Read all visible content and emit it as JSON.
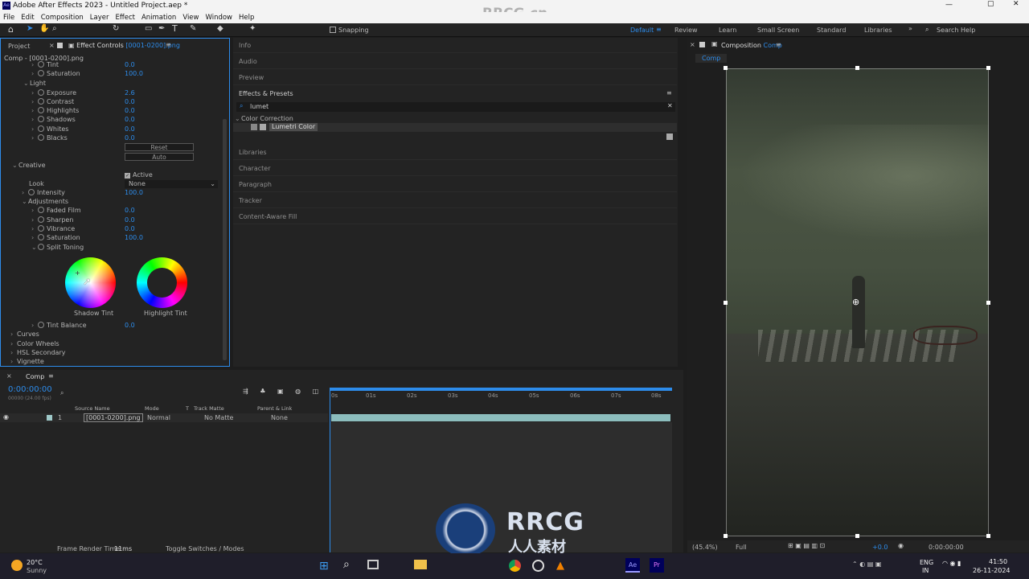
{
  "app": {
    "title": "Adobe After Effects 2023 - Untitled Project.aep *",
    "menu": [
      "File",
      "Edit",
      "Composition",
      "Layer",
      "Effect",
      "Animation",
      "View",
      "Window",
      "Help"
    ]
  },
  "watermark": "RRCG.cn",
  "toolbar": {
    "snapping": "Snapping",
    "workspaces": [
      "Default",
      "Review",
      "Learn",
      "Small Screen",
      "Standard",
      "Libraries"
    ],
    "search_placeholder": "Search Help"
  },
  "left_panel": {
    "tab_project": "Project",
    "tab_effect": "Effect Controls",
    "tab_effect_layer": "[0001-0200].png",
    "breadcrumb": "Comp - [0001-0200].png",
    "rows": [
      {
        "label": "Tint",
        "value": "0.0"
      },
      {
        "label": "Saturation",
        "value": "100.0"
      },
      {
        "label": "Light",
        "value": ""
      },
      {
        "label": "Exposure",
        "value": "2.6"
      },
      {
        "label": "Contrast",
        "value": "0.0"
      },
      {
        "label": "Highlights",
        "value": "0.0"
      },
      {
        "label": "Shadows",
        "value": "0.0"
      },
      {
        "label": "Whites",
        "value": "0.0"
      },
      {
        "label": "Blacks",
        "value": "0.0"
      }
    ],
    "reset": "Reset",
    "auto": "Auto",
    "creative": "Creative",
    "active": "Active",
    "look_label": "Look",
    "look_value": "None",
    "intensity": {
      "label": "Intensity",
      "value": "100.0"
    },
    "adjustments": "Adjustments",
    "adj_rows": [
      {
        "label": "Faded Film",
        "value": "0.0"
      },
      {
        "label": "Sharpen",
        "value": "0.0"
      },
      {
        "label": "Vibrance",
        "value": "0.0"
      },
      {
        "label": "Saturation",
        "value": "100.0"
      }
    ],
    "split_toning": "Split Toning",
    "shadow_tint": "Shadow Tint",
    "highlight_tint": "Highlight Tint",
    "tint_balance": {
      "label": "Tint Balance",
      "value": "0.0"
    },
    "sections": [
      "Curves",
      "Color Wheels",
      "HSL Secondary",
      "Vignette"
    ]
  },
  "middle_panel": {
    "info": "Info",
    "audio": "Audio",
    "preview": "Preview",
    "effects_presets": "Effects & Presets",
    "search_value": "lumet",
    "category": "Color Correction",
    "effect_item": "Lumetri Color",
    "libraries": "Libraries",
    "character": "Character",
    "paragraph": "Paragraph",
    "tracker": "Tracker",
    "content_aware": "Content-Aware Fill"
  },
  "comp_panel": {
    "title": "Composition",
    "comp_name": "Comp",
    "tab": "Comp",
    "zoom": "(45.4%)",
    "resolution": "Full",
    "timecode": "0:00:00:00",
    "exposure": "+0.0"
  },
  "timeline": {
    "tab": "Comp",
    "timecode": "0:00:00:00",
    "fps": "00000 (24.00 fps)",
    "columns": {
      "source": "Source Name",
      "mode": "Mode",
      "t": "T",
      "track": "Track Matte",
      "parent": "Parent & Link"
    },
    "layer": {
      "num": "1",
      "name": "[0001-0200].png",
      "mode": "Normal",
      "matte": "No Matte",
      "parent": "None"
    },
    "ticks": [
      "0s",
      "01s",
      "02s",
      "03s",
      "04s",
      "05s",
      "06s",
      "07s",
      "08s"
    ],
    "render_label": "Frame Render Time:",
    "render_value": "11ms",
    "toggle": "Toggle Switches / Modes"
  },
  "taskbar": {
    "temp": "20°C",
    "weather": "Sunny",
    "lang": "ENG",
    "lang2": "IN",
    "time": "41:50",
    "date": "26-11-2024"
  },
  "logo": {
    "text": "RRCG",
    "sub": "人人素材"
  },
  "colors": {
    "accent": "#2d8ceb",
    "panel": "#232323",
    "highlight": "#4d4d4d"
  }
}
